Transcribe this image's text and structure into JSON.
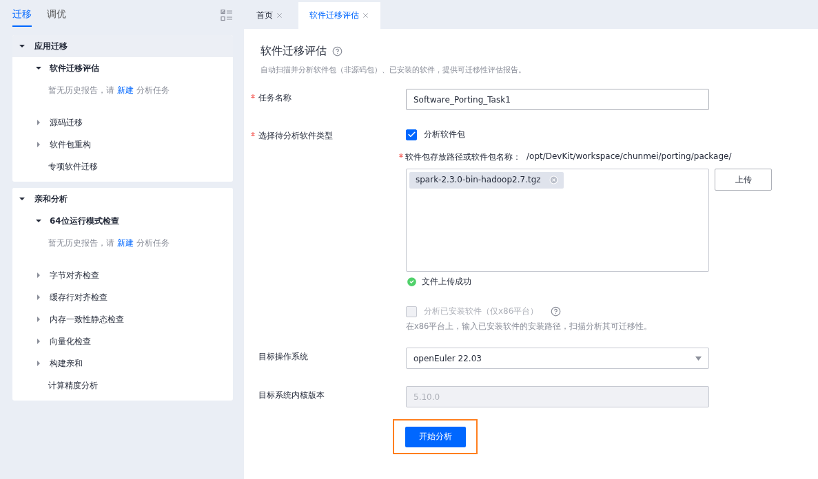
{
  "sidebar": {
    "tabs": [
      {
        "label": "迁移",
        "selected": true
      },
      {
        "label": "调优",
        "selected": false
      }
    ],
    "sections": [
      {
        "label": "应用迁移",
        "expanded": true,
        "selected": true,
        "children": [
          {
            "kind": "group",
            "label": "软件迁移评估",
            "expanded": true,
            "empty_message": {
              "before": "暂无历史报告，请",
              "link": "新建",
              "after": "分析任务"
            }
          },
          {
            "kind": "group",
            "label": "源码迁移",
            "expanded": false
          },
          {
            "kind": "group",
            "label": "软件包重构",
            "expanded": false
          },
          {
            "kind": "leaf",
            "label": "专项软件迁移"
          }
        ]
      },
      {
        "label": "亲和分析",
        "expanded": true,
        "selected": false,
        "children": [
          {
            "kind": "group",
            "label": "64位运行模式检查",
            "expanded": true,
            "empty_message": {
              "before": "暂无历史报告，请",
              "link": "新建",
              "after": "分析任务"
            }
          },
          {
            "kind": "group",
            "label": "字节对齐检查",
            "expanded": false
          },
          {
            "kind": "group",
            "label": "缓存行对齐检查",
            "expanded": false
          },
          {
            "kind": "group",
            "label": "内存一致性静态检查",
            "expanded": false
          },
          {
            "kind": "group",
            "label": "向量化检查",
            "expanded": false
          },
          {
            "kind": "group",
            "label": "构建亲和",
            "expanded": false
          },
          {
            "kind": "leaf",
            "label": "计算精度分析"
          }
        ]
      }
    ]
  },
  "tabs": [
    {
      "label": "首页",
      "selected": false
    },
    {
      "label": "软件迁移评估",
      "selected": true
    }
  ],
  "page": {
    "title": "软件迁移评估",
    "description": "自动扫描并分析软件包（非源码包）、已安装的软件，提供可迁移性评估报告。"
  },
  "form": {
    "task_name": {
      "label": "任务名称",
      "required": true,
      "value": "Software_Porting_Task1"
    },
    "software_type": {
      "label": "选择待分析软件类型",
      "required": true,
      "package_option": {
        "label": "分析软件包",
        "checked": true
      },
      "package_path": {
        "label": "软件包存放路径或软件包名称：",
        "required": true,
        "path": "/opt/DevKit/workspace/chunmei/porting/package/"
      },
      "files": [
        "spark-2.3.0-bin-hadoop2.7.tgz"
      ],
      "upload_button": "上传",
      "upload_status": "文件上传成功",
      "installed_option": {
        "label": "分析已安装软件（仅x86平台）",
        "checked": false,
        "disabled": true
      },
      "installed_hint": "在x86平台上，输入已安装软件的安装路径，扫描分析其可迁移性。"
    },
    "target_os": {
      "label": "目标操作系统",
      "value": "openEuler 22.03"
    },
    "kernel": {
      "label": "目标系统内核版本",
      "value": "5.10.0",
      "disabled": true
    },
    "submit": {
      "label": "开始分析",
      "highlighted": true
    }
  }
}
